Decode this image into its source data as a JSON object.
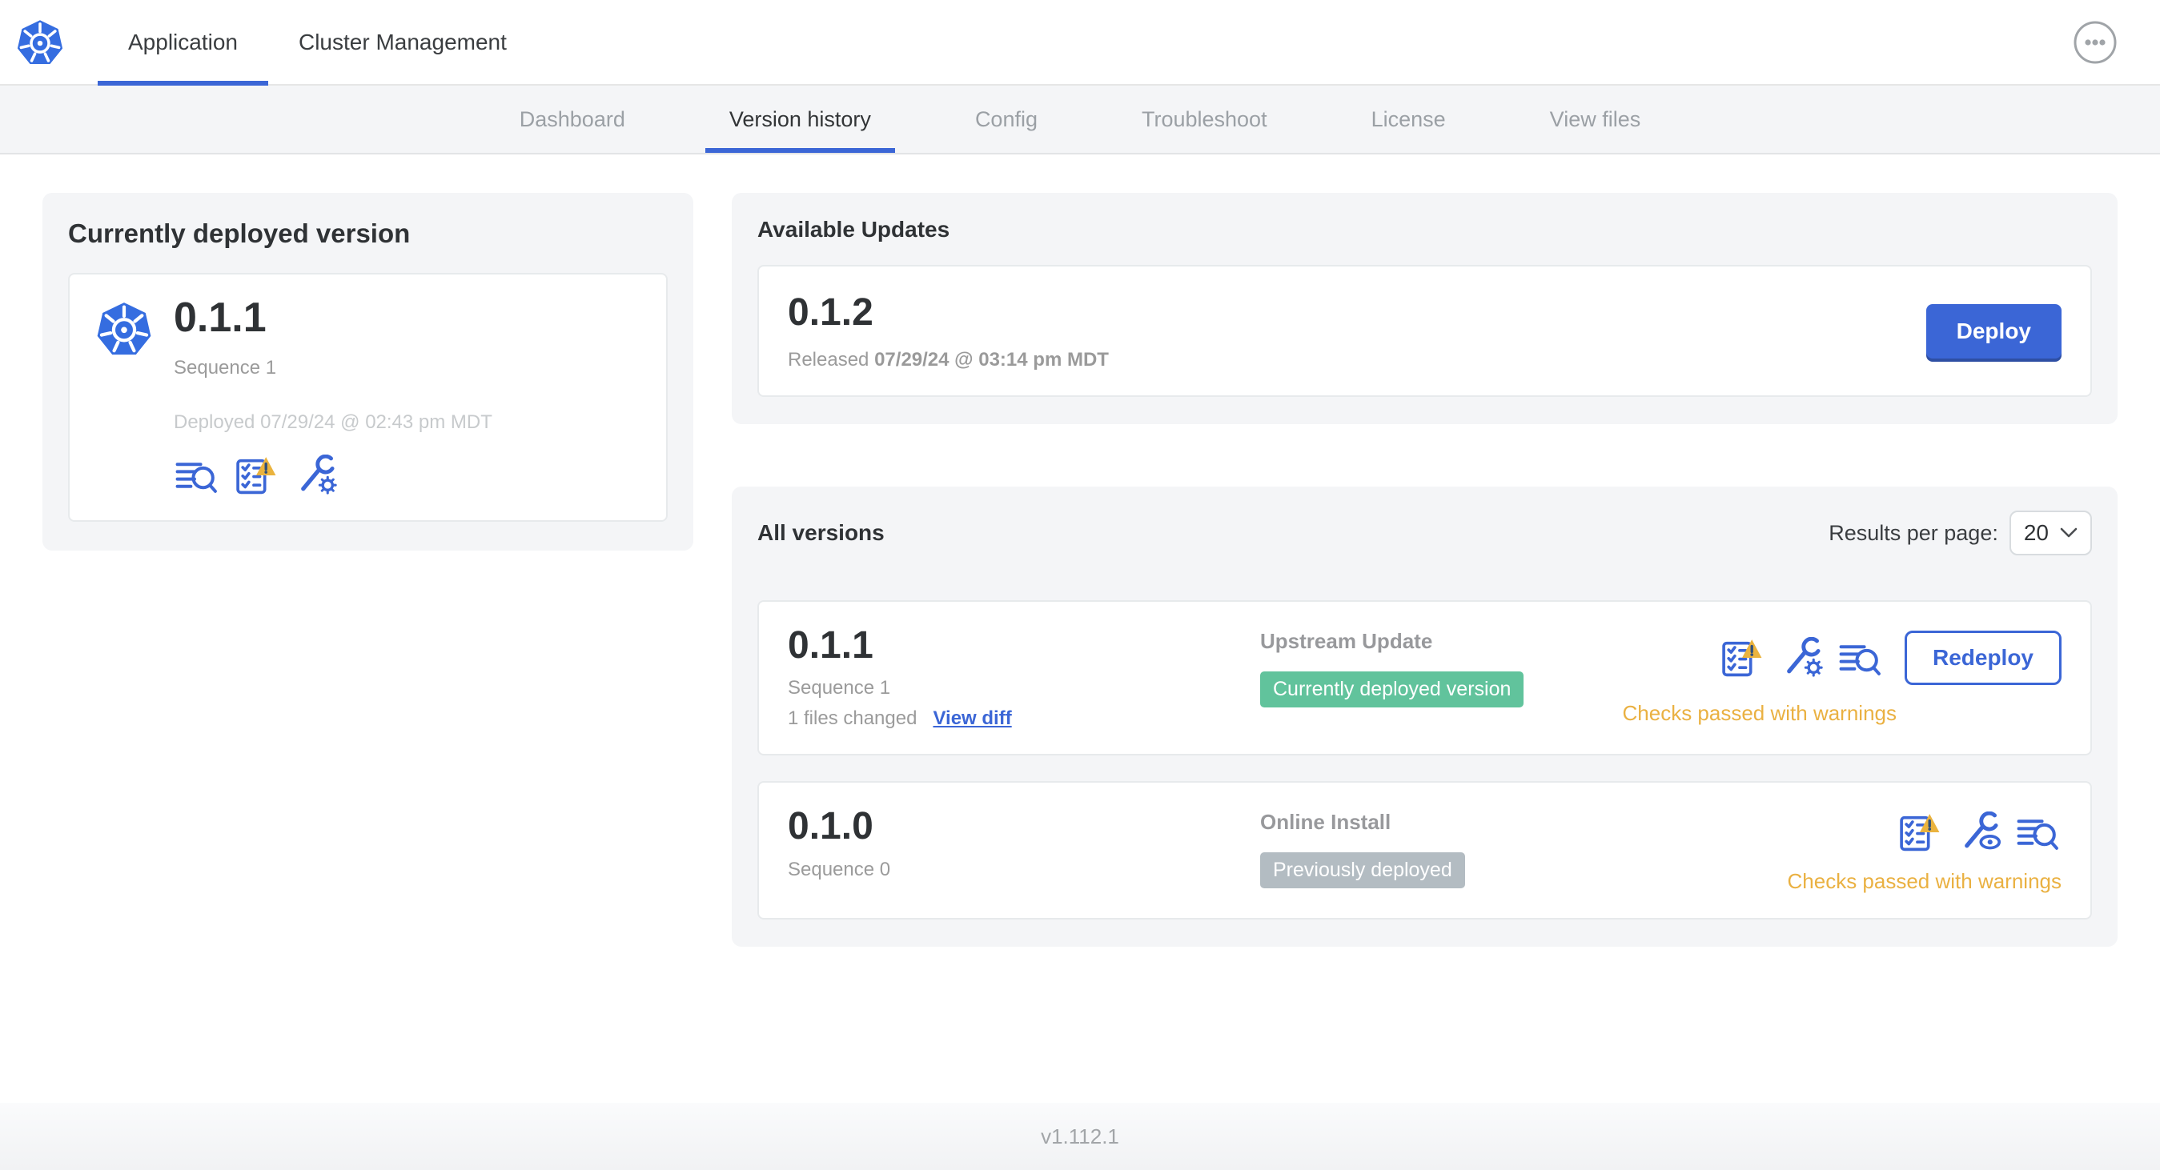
{
  "header": {
    "tabs": [
      {
        "label": "Application",
        "active": true
      },
      {
        "label": "Cluster Management",
        "active": false
      }
    ]
  },
  "subnav": {
    "tabs": [
      {
        "label": "Dashboard",
        "active": false
      },
      {
        "label": "Version history",
        "active": true
      },
      {
        "label": "Config",
        "active": false
      },
      {
        "label": "Troubleshoot",
        "active": false
      },
      {
        "label": "License",
        "active": false
      },
      {
        "label": "View files",
        "active": false
      }
    ]
  },
  "deployed_card": {
    "title": "Currently deployed version",
    "version": "0.1.1",
    "sequence": "Sequence 1",
    "deployed": "Deployed 07/29/24 @ 02:43 pm MDT",
    "icons": [
      "logs-icon",
      "preflight-warning-icon",
      "config-gear-icon"
    ]
  },
  "updates_card": {
    "title": "Available Updates",
    "version": "0.1.2",
    "released_prefix": "Released",
    "released_date": "07/29/24 @ 03:14 pm MDT",
    "deploy_label": "Deploy"
  },
  "versions_card": {
    "title": "All versions",
    "results_label": "Results per page:",
    "results_value": "20",
    "rows": [
      {
        "version": "0.1.1",
        "sequence": "Sequence 1",
        "files_changed": "1 files changed",
        "diff_link": "View diff",
        "source": "Upstream Update",
        "badge": {
          "label": "Currently deployed version",
          "type": "green"
        },
        "icons": [
          "preflight-warning-icon",
          "config-gear-icon",
          "logs-icon"
        ],
        "action_label": "Redeploy",
        "status": "Checks passed with warnings"
      },
      {
        "version": "0.1.0",
        "sequence": "Sequence 0",
        "source": "Online Install",
        "badge": {
          "label": "Previously deployed",
          "type": "gray"
        },
        "icons": [
          "preflight-warning-icon",
          "config-eye-icon",
          "logs-icon"
        ],
        "status": "Checks passed with warnings"
      }
    ]
  },
  "footer": {
    "version": "v1.112.1"
  },
  "colors": {
    "accent": "#3b66d6",
    "green": "#61c39c",
    "gray_badge": "#b3bcc2",
    "warning": "#eab142",
    "k8s_blue": "#356de0"
  }
}
